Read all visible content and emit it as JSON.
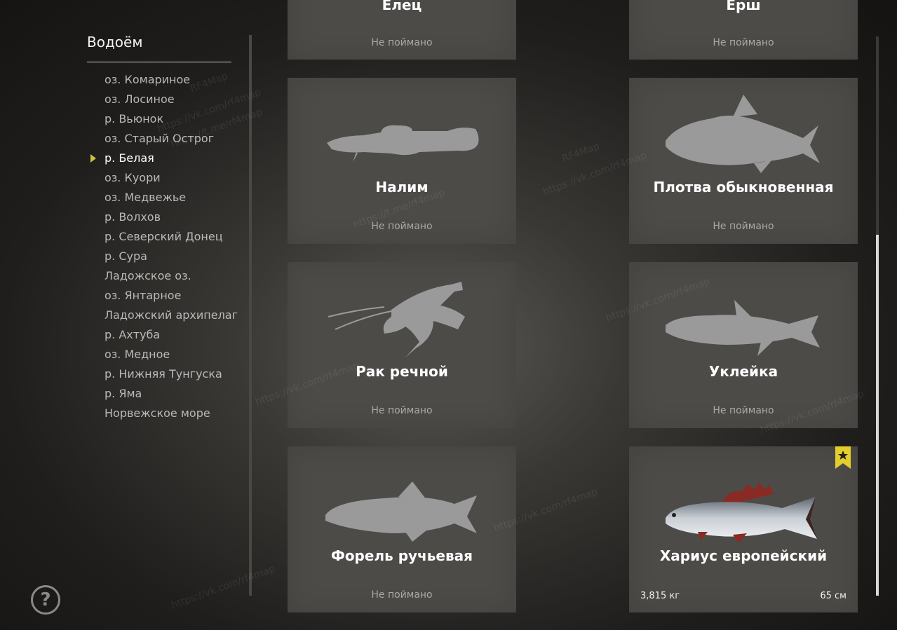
{
  "sidebar": {
    "title": "Водоём",
    "items": [
      {
        "label": "оз. Комариное"
      },
      {
        "label": "оз. Лосиное"
      },
      {
        "label": "р. Вьюнок"
      },
      {
        "label": "оз. Старый Острог"
      },
      {
        "label": "р. Белая",
        "active": true
      },
      {
        "label": "оз. Куори"
      },
      {
        "label": "оз. Медвежье"
      },
      {
        "label": "р. Волхов"
      },
      {
        "label": "р. Северский Донец"
      },
      {
        "label": "р. Сура"
      },
      {
        "label": "Ладожское оз."
      },
      {
        "label": "оз. Янтарное"
      },
      {
        "label": "Ладожский архипелаг"
      },
      {
        "label": "р. Ахтуба"
      },
      {
        "label": "оз. Медное"
      },
      {
        "label": "р. Нижняя Тунгуска"
      },
      {
        "label": "р. Яма"
      },
      {
        "label": "Норвежское море"
      }
    ],
    "help_label": "?"
  },
  "fish_cards": [
    {
      "name": "Елец",
      "status": "Не поймано",
      "icon": "fish-silhouette"
    },
    {
      "name": "Ёрш",
      "status": "Не поймано",
      "icon": "fish-silhouette"
    },
    {
      "name": "Налим",
      "status": "Не поймано",
      "icon": "burbot-silhouette"
    },
    {
      "name": "Плотва обыкновенная",
      "status": "Не поймано",
      "icon": "roach-silhouette"
    },
    {
      "name": "Рак речной",
      "status": "Не поймано",
      "icon": "crayfish-silhouette"
    },
    {
      "name": "Уклейка",
      "status": "Не поймано",
      "icon": "bleak-silhouette"
    },
    {
      "name": "Форель ручьевая",
      "status": "Не поймано",
      "icon": "trout-silhouette"
    },
    {
      "name": "Хариус европейский",
      "weight": "3,815 кг",
      "length": "65 см",
      "icon": "grayling-image",
      "caught": true
    }
  ],
  "colors": {
    "card_bg": "#4d4b48",
    "silhouette": "#9a9a9a",
    "accent_arrow": "#c9c23a",
    "bookmark": "#e3cf2b"
  },
  "watermark": [
    "RF4Map",
    "https://vk.com/rf4map",
    "https://t.me/rf4map"
  ]
}
